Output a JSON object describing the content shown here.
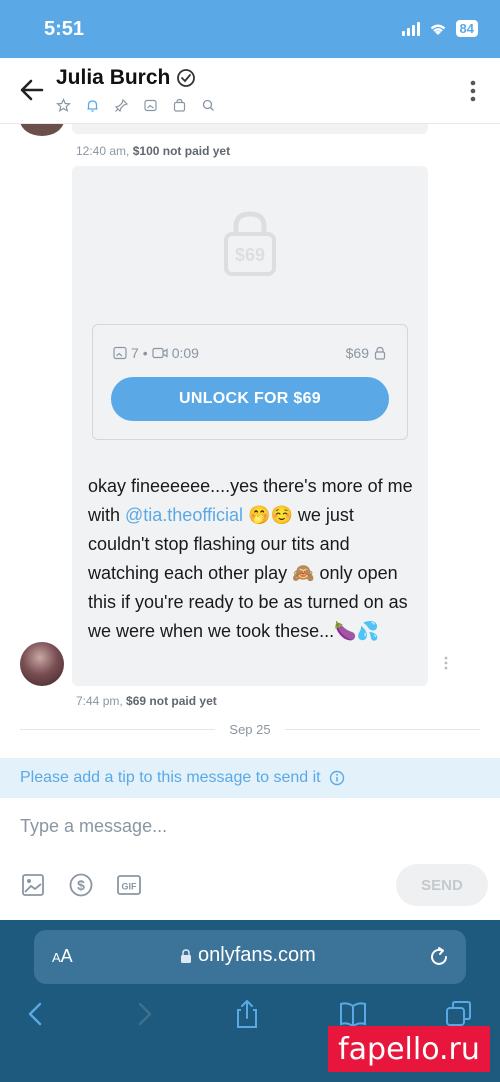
{
  "status_bar": {
    "time": "5:51",
    "battery": "84"
  },
  "header": {
    "name": "Julia Burch"
  },
  "messages": {
    "first_meta_time": "12:40 am,",
    "first_meta_price": "$100 not paid yet",
    "lock_price": "$69",
    "photo_count": "7",
    "separator": "•",
    "video_duration": "0:09",
    "price": "$69",
    "unlock_label": "UNLOCK FOR $69",
    "text_part1": "okay fineeeeee....yes there's more of me with ",
    "mention": "@tia.theofficial",
    "text_part2": " 🤭☺️ we just couldn't stop flashing our tits and watching each other play 🙈 only open this if you're ready to be as turned on as we were when we took these...🍆💦",
    "second_meta_time": "7:44 pm,",
    "second_meta_price": "$69 not paid yet",
    "date_separator": "Sep 25"
  },
  "tip_banner": {
    "text": "Please add a tip to this message to send it"
  },
  "composer": {
    "placeholder": "Type a message...",
    "send_label": "SEND"
  },
  "browser": {
    "aa_small": "A",
    "aa_large": "A",
    "url": "onlyfans.com"
  },
  "watermark": {
    "text": "fapello.ru"
  },
  "colors": {
    "accent": "#5aa9e6",
    "bubble": "#f1f2f3",
    "browser_bar": "#1d5a7e",
    "watermark": "#e8163c"
  }
}
